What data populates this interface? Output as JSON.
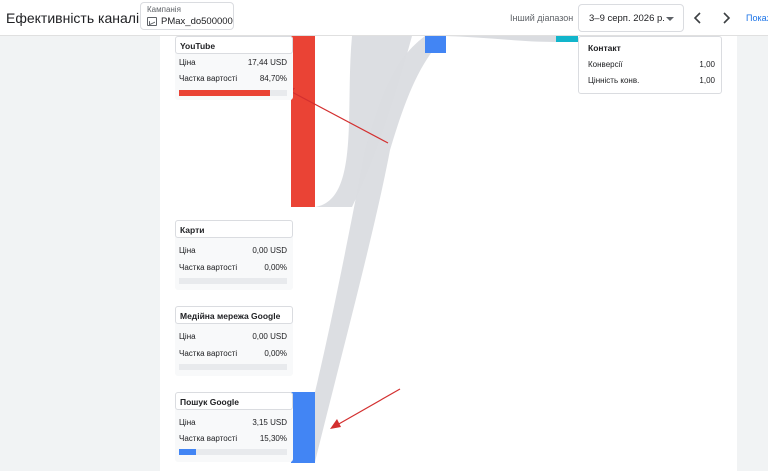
{
  "header": {
    "title": "Ефективність каналів",
    "campaign_label": "Кампанія",
    "campaign_value": "PMax_do500000",
    "range_label": "Інший діапазон",
    "date_range": "3–9 серп. 2026 р.",
    "show_label": "Показ"
  },
  "channels": [
    {
      "name": "YouTube",
      "cost_label": "Ціна",
      "cost": "17,44 USD",
      "share_label": "Частка вартості",
      "share": "84,70%",
      "share_value": 0.847,
      "color": "#ea4335"
    },
    {
      "name": "Карти",
      "cost_label": "Ціна",
      "cost": "0,00 USD",
      "share_label": "Частка вартості",
      "share": "0,00%",
      "share_value": 0.0,
      "color": "#ea4335"
    },
    {
      "name": "Медійна мережа Google",
      "cost_label": "Ціна",
      "cost": "0,00 USD",
      "share_label": "Частка вартості",
      "share": "0,00%",
      "share_value": 0.0,
      "color": "#ea4335"
    },
    {
      "name": "Пошук Google",
      "cost_label": "Ціна",
      "cost": "3,15 USD",
      "share_label": "Частка вартості",
      "share": "15,30%",
      "share_value": 0.153,
      "color": "#4285f4"
    }
  ],
  "contact": {
    "title": "Контакт",
    "rows": [
      {
        "label": "Конверсії",
        "value": "1,00"
      },
      {
        "label": "Цінність конв.",
        "value": "1,00"
      }
    ]
  },
  "colors": {
    "youtube": "#ea4335",
    "search": "#4285f4",
    "teal": "#12b5cb",
    "flow": "#dadce0",
    "arrow": "#d32f2f",
    "link": "#1a73e8"
  }
}
